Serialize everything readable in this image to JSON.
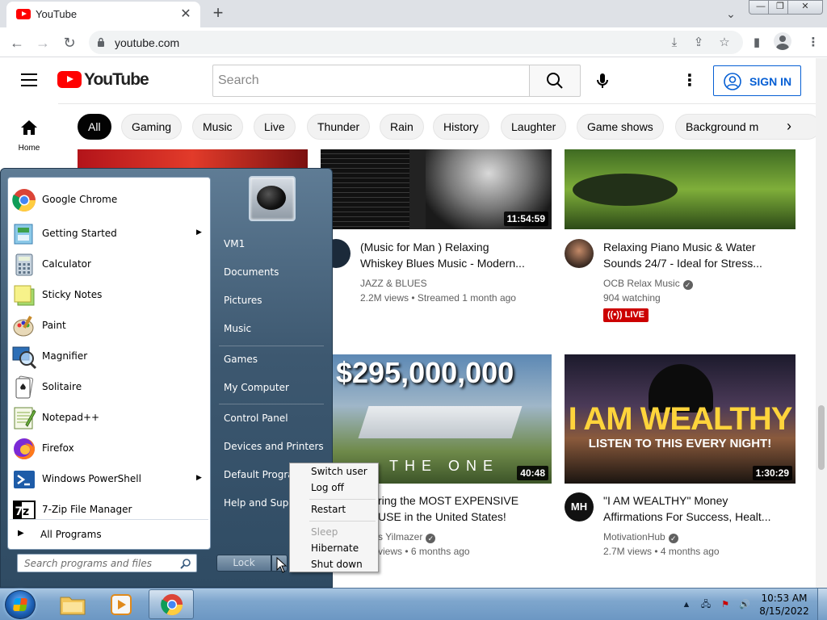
{
  "browser": {
    "tab_title": "YouTube",
    "url": "youtube.com"
  },
  "youtube": {
    "logo_text": "YouTube",
    "search_placeholder": "Search",
    "signin_label": "SIGN IN",
    "home_label": "Home",
    "chips": [
      "All",
      "Gaming",
      "Music",
      "Live",
      "Thunder",
      "Rain",
      "History",
      "Laughter",
      "Game shows",
      "Background m"
    ],
    "videos": [
      {
        "duration": "11:54:59",
        "title_line1": "(Music for Man ) Relaxing",
        "title_line2": "Whiskey Blues Music - Modern...",
        "channel": "JAZZ & BLUES",
        "stats": "2.2M views • Streamed 1 month ago"
      },
      {
        "title_line1": "Relaxing Piano Music & Water",
        "title_line2": "Sounds 24/7 - Ideal for Stress...",
        "channel": "OCB Relax Music",
        "stats": "904 watching",
        "live": "LIVE"
      },
      {
        "duration": "40:48",
        "thumb_text": "$295,000,000",
        "thumb_sub": "THE ONE",
        "title_line1": "ring the MOST EXPENSIVE",
        "title_line2": "USE in the United States!",
        "channel": "s Yilmazer",
        "stats": "views • 6 months ago"
      },
      {
        "duration": "1:30:29",
        "thumb_text": "I AM WEALTHY",
        "thumb_sub": "LISTEN TO THIS EVERY NIGHT!",
        "title_line1": "\"I AM WEALTHY\" Money",
        "title_line2": "Affirmations For Success, Healt...",
        "channel": "MotivationHub",
        "stats": "2.7M views • 4 months ago",
        "avatar_text": "MH"
      }
    ]
  },
  "start_menu": {
    "programs": [
      {
        "label": "Google Chrome",
        "icon": "chrome-icon"
      },
      {
        "label": "Getting Started",
        "icon": "getting-started-icon",
        "submenu": true
      },
      {
        "label": "Calculator",
        "icon": "calculator-icon"
      },
      {
        "label": "Sticky Notes",
        "icon": "sticky-notes-icon"
      },
      {
        "label": "Paint",
        "icon": "paint-icon"
      },
      {
        "label": "Magnifier",
        "icon": "magnifier-icon"
      },
      {
        "label": "Solitaire",
        "icon": "solitaire-icon"
      },
      {
        "label": "Notepad++",
        "icon": "notepadpp-icon"
      },
      {
        "label": "Firefox",
        "icon": "firefox-icon"
      },
      {
        "label": "Windows PowerShell",
        "icon": "powershell-icon",
        "submenu": true
      },
      {
        "label": "7-Zip File Manager",
        "icon": "7zip-icon"
      }
    ],
    "all_programs": "All Programs",
    "search_placeholder": "Search programs and files",
    "right_items": [
      "VM1",
      "Documents",
      "Pictures",
      "Music",
      "Games",
      "My Computer",
      "Control Panel",
      "Devices and Printers",
      "Default Programs",
      "Help and Support"
    ],
    "lock_label": "Lock",
    "power_menu": [
      "Switch user",
      "Log off",
      "Restart",
      "Sleep",
      "Hibernate",
      "Shut down"
    ]
  },
  "taskbar": {
    "time": "10:53 AM",
    "date": "8/15/2022"
  }
}
